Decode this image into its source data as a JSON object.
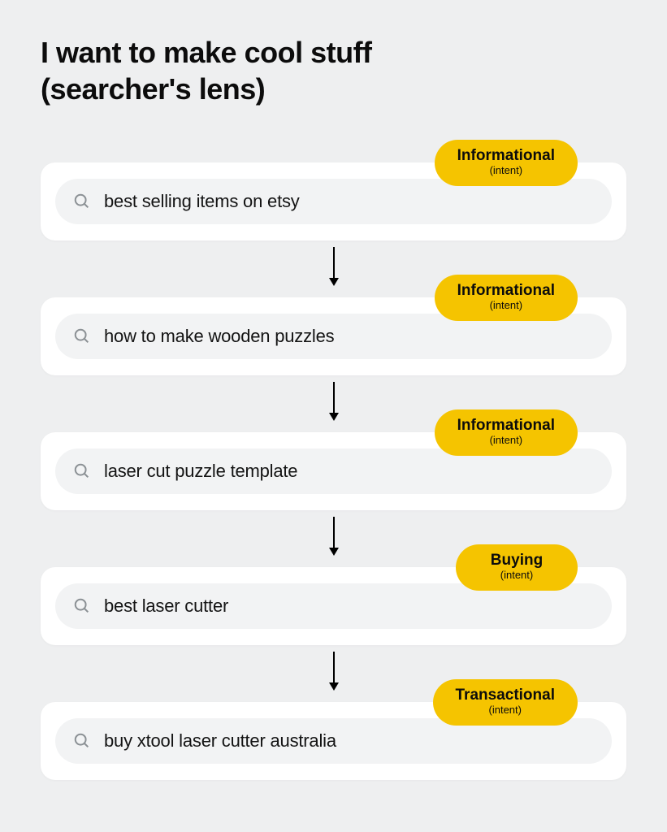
{
  "title_line1": "I want to make cool stuff",
  "title_line2": "(searcher's lens)",
  "badge_subtext": "(intent)",
  "badge_color": "#f5c400",
  "steps": [
    {
      "query": "best selling items on etsy",
      "intent": "Informational"
    },
    {
      "query": "how to make wooden puzzles",
      "intent": "Informational"
    },
    {
      "query": "laser cut puzzle template",
      "intent": "Informational"
    },
    {
      "query": "best laser cutter",
      "intent": "Buying"
    },
    {
      "query": "buy xtool laser cutter australia",
      "intent": "Transactional"
    }
  ]
}
